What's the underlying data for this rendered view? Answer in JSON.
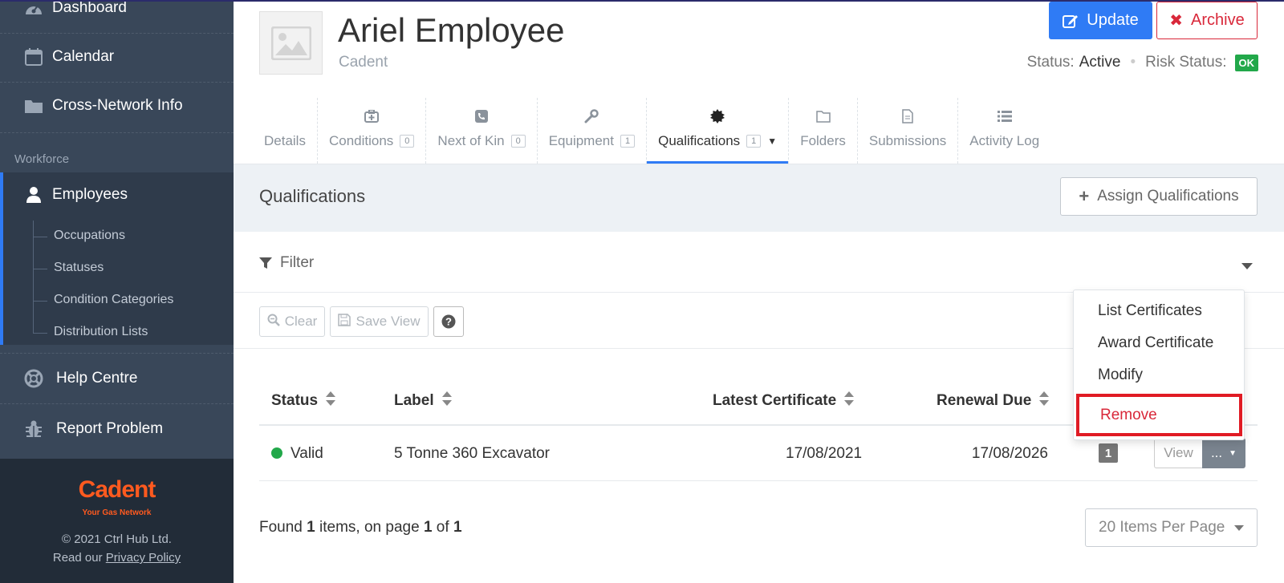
{
  "sidebar": {
    "items": [
      {
        "label": "Dashboard",
        "icon": "dashboard-icon"
      },
      {
        "label": "Calendar",
        "icon": "calendar-icon"
      },
      {
        "label": "Cross-Network Info",
        "icon": "folder-icon"
      }
    ],
    "section_title": "Workforce",
    "employees_label": "Employees",
    "sub_items": [
      "Occupations",
      "Statuses",
      "Condition Categories",
      "Distribution Lists"
    ],
    "help_label": "Help Centre",
    "report_label": "Report Problem",
    "footer": {
      "brand": "Cadent",
      "tagline": "Your Gas Network",
      "copyright": "© 2021 Ctrl Hub Ltd.",
      "read_prefix": "Read our",
      "privacy_link": "Privacy Policy"
    }
  },
  "header": {
    "name": "Ariel Employee",
    "company": "Cadent",
    "update_label": "Update",
    "archive_label": "Archive",
    "status_label": "Status:",
    "status_value": "Active",
    "risk_label": "Risk Status:",
    "risk_value": "OK"
  },
  "tabs": [
    {
      "label": "Details",
      "count": null,
      "icon": ""
    },
    {
      "label": "Conditions",
      "count": "0",
      "icon": "medkit-icon"
    },
    {
      "label": "Next of Kin",
      "count": "0",
      "icon": "phone-icon"
    },
    {
      "label": "Equipment",
      "count": "1",
      "icon": "wrench-icon"
    },
    {
      "label": "Qualifications",
      "count": "1",
      "icon": "certificate-icon",
      "active": true
    },
    {
      "label": "Folders",
      "count": null,
      "icon": "folder-outline-icon"
    },
    {
      "label": "Submissions",
      "count": null,
      "icon": "document-icon"
    },
    {
      "label": "Activity Log",
      "count": null,
      "icon": "list-icon"
    }
  ],
  "qualifications": {
    "title": "Qualifications",
    "assign_label": "Assign Qualifications",
    "filter_label": "Filter",
    "clear_label": "Clear",
    "save_view_label": "Save View",
    "columns": [
      "Status",
      "Label",
      "Latest Certificate",
      "Renewal Due"
    ],
    "rows": [
      {
        "status": "Valid",
        "label": "5 Tonne 360 Excavator",
        "latest_certificate": "17/08/2021",
        "renewal_due": "17/08/2026",
        "count": "1"
      }
    ],
    "view_label": "View",
    "more_label": "...",
    "found": {
      "prefix": "Found",
      "items": "1",
      "mid": "items, on page",
      "page": "1",
      "of": "of",
      "total": "1"
    },
    "per_page": "20 Items Per Page"
  },
  "dropdown": {
    "items": [
      "List Certificates",
      "Award Certificate",
      "Modify",
      "Remove"
    ]
  },
  "colors": {
    "sidebar_bg": "#394759",
    "accent_blue": "#2f7bf5",
    "danger_red": "#d9283a",
    "ok_green": "#22a84a",
    "brand_orange": "#ff5a1f"
  }
}
